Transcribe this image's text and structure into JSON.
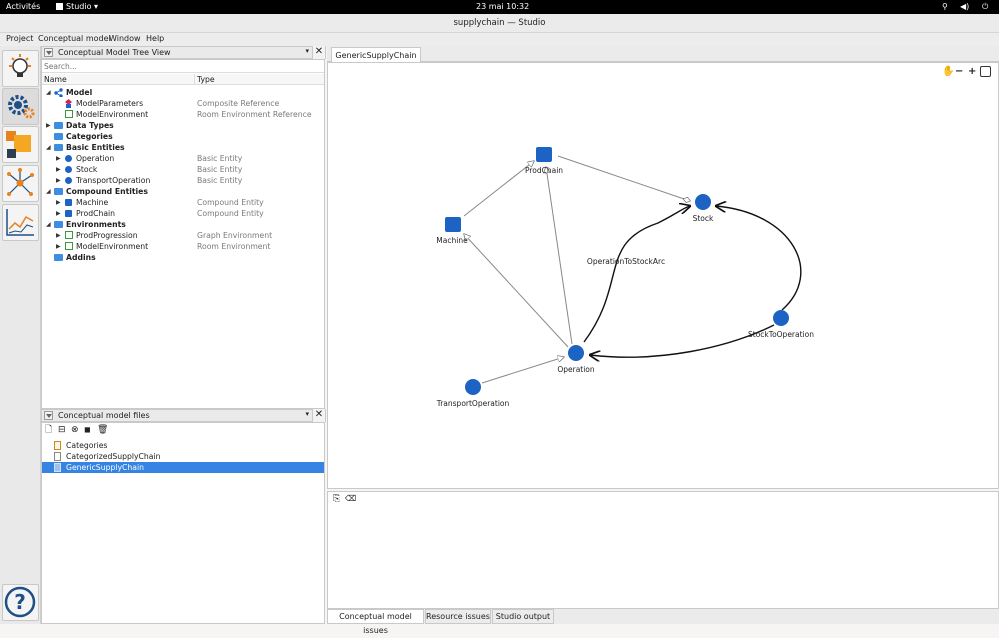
{
  "topbar": {
    "activities": "Activités",
    "app": "Studio ▾",
    "clock": "23 mai  10:32"
  },
  "window": {
    "title": "supplychain — Studio"
  },
  "menu": [
    "Project",
    "Conceptual model",
    "Window",
    "Help"
  ],
  "tree_panel": {
    "title": "Conceptual Model Tree View",
    "search_placeholder": "Search...",
    "col_name": "Name",
    "col_type": "Type",
    "rows": [
      {
        "label": "Model",
        "type": "",
        "bold": true
      },
      {
        "label": "ModelParameters",
        "type": "Composite Reference"
      },
      {
        "label": "ModelEnvironment",
        "type": "Room Environment Reference"
      },
      {
        "label": "Data Types",
        "type": "",
        "bold": true
      },
      {
        "label": "Categories",
        "type": "",
        "bold": true
      },
      {
        "label": "Basic Entities",
        "type": "",
        "bold": true
      },
      {
        "label": "Operation",
        "type": "Basic Entity"
      },
      {
        "label": "Stock",
        "type": "Basic Entity"
      },
      {
        "label": "TransportOperation",
        "type": "Basic Entity"
      },
      {
        "label": "Compound Entities",
        "type": "",
        "bold": true
      },
      {
        "label": "Machine",
        "type": "Compound Entity"
      },
      {
        "label": "ProdChain",
        "type": "Compound Entity"
      },
      {
        "label": "Environments",
        "type": "",
        "bold": true
      },
      {
        "label": "ProdProgression",
        "type": "Graph Environment"
      },
      {
        "label": "ModelEnvironment",
        "type": "Room Environment"
      },
      {
        "label": "Addins",
        "type": "",
        "bold": true
      }
    ]
  },
  "files_panel": {
    "title": "Conceptual model files",
    "files": [
      "Categories",
      "CategorizedSupplyChain",
      "GenericSupplyChain"
    ]
  },
  "editor": {
    "tab": "GenericSupplyChain",
    "nodes": {
      "prodchain": "ProdChain",
      "machine": "Machine",
      "stock": "Stock",
      "operation": "Operation",
      "transport": "TransportOperation",
      "stocktooperation": "StockToOperation"
    },
    "arc_label": "OperationToStockArc"
  },
  "bottom_tabs": [
    "Conceptual model issues",
    "Resource issues",
    "Studio output"
  ],
  "colors": {
    "node": "#1c63c4",
    "selection": "#3584e4"
  }
}
